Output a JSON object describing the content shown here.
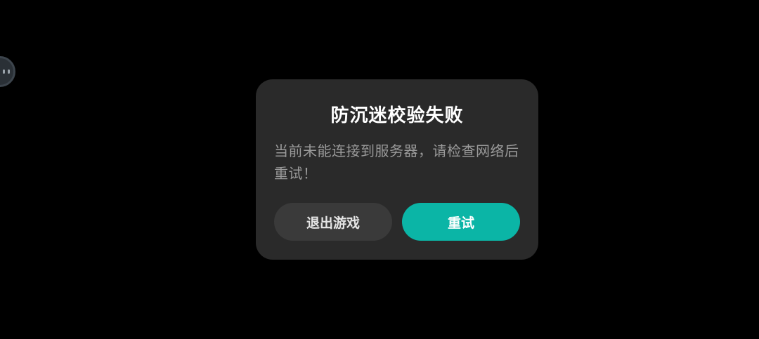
{
  "dialog": {
    "title": "防沉迷校验失败",
    "message": "当前未能连接到服务器，请检查网络后重试！",
    "buttons": {
      "exit_label": "退出游戏",
      "retry_label": "重试"
    }
  },
  "float_ball": {
    "icon": "assistant-face-icon"
  },
  "colors": {
    "background": "#000000",
    "dialog_bg": "#2a2a2a",
    "exit_button_bg": "#3a3a3a",
    "retry_button_bg": "#0bb5a6",
    "message_text": "#9a9a9a"
  }
}
